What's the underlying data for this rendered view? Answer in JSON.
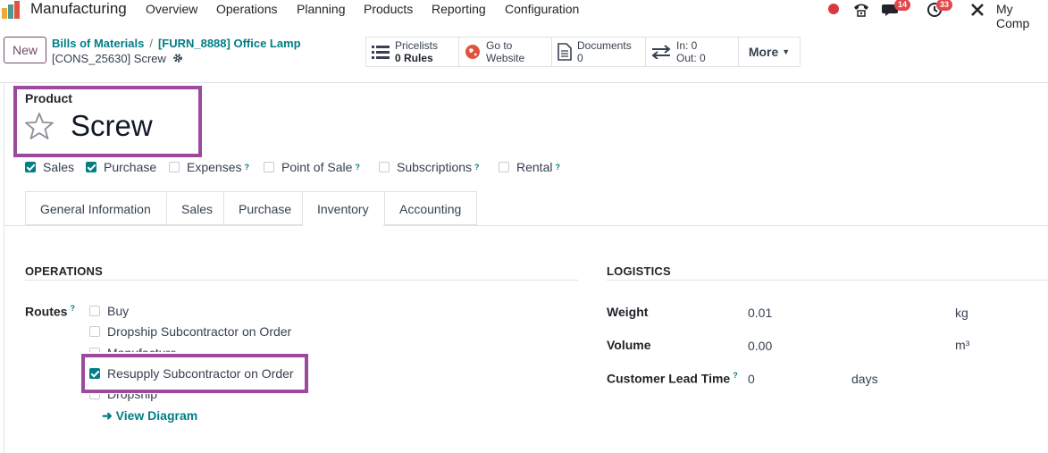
{
  "nav": {
    "app_name": "Manufacturing",
    "menu": [
      "Overview",
      "Operations",
      "Planning",
      "Products",
      "Reporting",
      "Configuration"
    ],
    "messages_badge": "14",
    "activities_badge": "33",
    "company": "My Comp",
    "status_color": "#d9383f"
  },
  "control": {
    "new_label": "New",
    "breadcrumb": [
      "Bills of Materials",
      "[FURN_8888] Office Lamp"
    ],
    "record_name": "[CONS_25630] Screw",
    "smart_buttons": [
      {
        "icon": "list-icon",
        "line1": "Pricelists",
        "line2": "0 Rules"
      },
      {
        "icon": "globe-icon",
        "line1": "Go to",
        "line2": "Website"
      },
      {
        "icon": "document-icon",
        "line1": "Documents",
        "line2": "0"
      },
      {
        "icon": "exchange-icon",
        "line1": "In: 0",
        "line2": "Out: 0"
      }
    ],
    "more_label": "More"
  },
  "form": {
    "product_label": "Product",
    "product_name": "Screw",
    "flags": [
      {
        "label": "Sales",
        "checked": true,
        "help": false
      },
      {
        "label": "Purchase",
        "checked": true,
        "help": false
      },
      {
        "label": "Expenses",
        "checked": false,
        "help": true
      },
      {
        "label": "Point of Sale",
        "checked": false,
        "help": true
      },
      {
        "label": "Subscriptions",
        "checked": false,
        "help": true
      },
      {
        "label": "Rental",
        "checked": false,
        "help": true
      }
    ],
    "help_mark": "?",
    "tabs": [
      "General Information",
      "Sales",
      "Purchase",
      "Inventory",
      "Accounting"
    ],
    "active_tab": "Inventory"
  },
  "operations": {
    "title": "OPERATIONS",
    "routes_label": "Routes",
    "routes": [
      {
        "label": "Buy",
        "checked": false
      },
      {
        "label": "Dropship Subcontractor on Order",
        "checked": false
      },
      {
        "label": "Manufacture",
        "checked": false
      },
      {
        "label": "Resupply Subcontractor on Order",
        "checked": true
      },
      {
        "label": "Dropship",
        "checked": false
      }
    ],
    "view_diagram": "View Diagram"
  },
  "logistics": {
    "title": "LOGISTICS",
    "weight_label": "Weight",
    "weight_value": "0.01",
    "weight_unit": "kg",
    "volume_label": "Volume",
    "volume_value": "0.00",
    "volume_unit": "m³",
    "lead_label": "Customer Lead Time",
    "lead_value": "0",
    "lead_unit": "days"
  },
  "colors": {
    "accent": "#017e84",
    "brand": "#714b67",
    "highlight": "#9b4a9e"
  }
}
